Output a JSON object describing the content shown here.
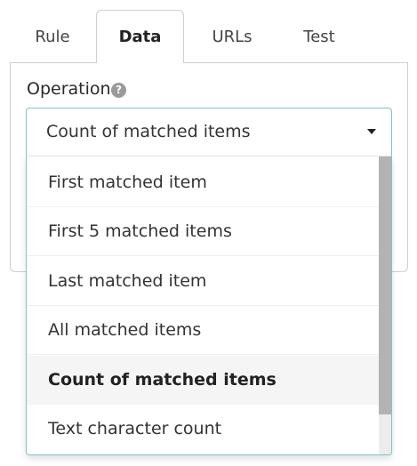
{
  "tabs": [
    {
      "label": "Rule"
    },
    {
      "label": "Data",
      "active": true
    },
    {
      "label": "URLs"
    },
    {
      "label": "Test"
    }
  ],
  "operation": {
    "label": "Operation",
    "help_icon": "question-circle-icon",
    "help_glyph": "?",
    "selected_value": "Count of matched items",
    "options": [
      {
        "label": "First matched item"
      },
      {
        "label": "First 5 matched items"
      },
      {
        "label": "Last matched item"
      },
      {
        "label": "All matched items"
      },
      {
        "label": "Count of matched items",
        "selected": true
      },
      {
        "label": "Text character count"
      }
    ]
  },
  "colors": {
    "focus_border": "#7fc4c4",
    "scroll_thumb": "#b3b3b3",
    "selected_bg": "#f5f5f5"
  }
}
